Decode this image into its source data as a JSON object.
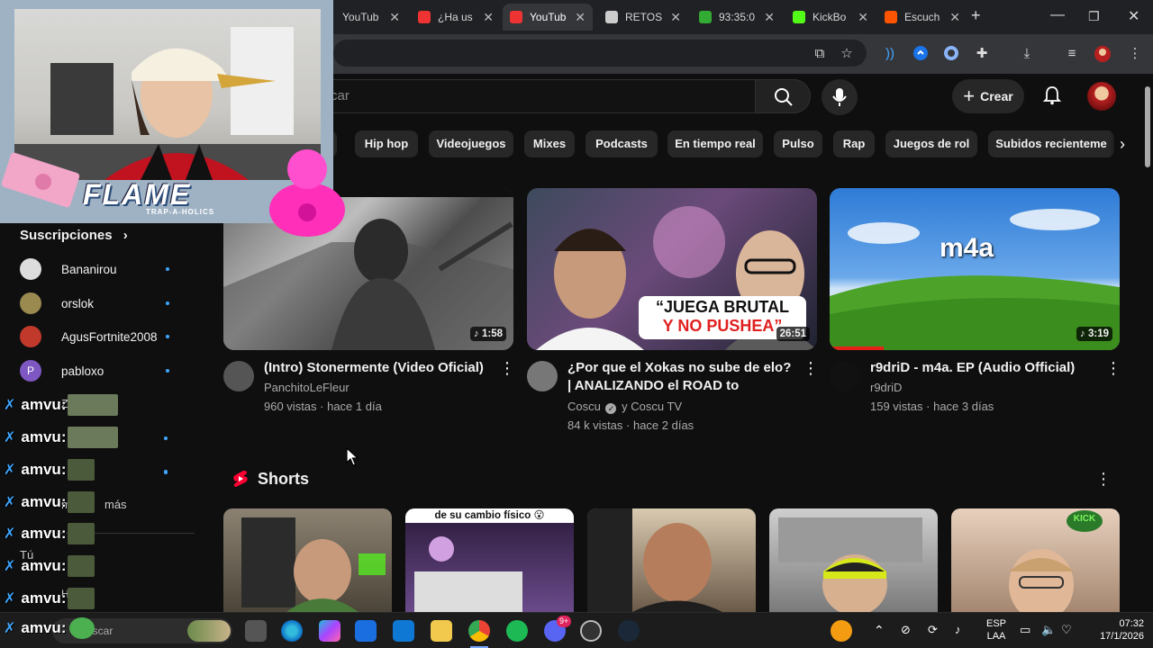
{
  "browser": {
    "tabs": [
      {
        "title": "YouTub",
        "active": false,
        "fav": "#e33"
      },
      {
        "title": "¿Ha us",
        "active": false,
        "fav": "#e33"
      },
      {
        "title": "YouTub",
        "active": true,
        "fav": "#e33"
      },
      {
        "title": "RETOS",
        "active": false,
        "fav": "#ccc"
      },
      {
        "title": "93:35:0",
        "active": false,
        "fav": "#3a3"
      },
      {
        "title": "KickBo",
        "active": false,
        "fav": "#53fc18"
      },
      {
        "title": "Escuch",
        "active": false,
        "fav": "#f50"
      }
    ],
    "new_tab_label": "+"
  },
  "youtube": {
    "search_placeholder": "car",
    "create_label": "Crear",
    "chips": [
      "Hip hop",
      "Videojuegos",
      "Mixes",
      "Podcasts",
      "En tiempo real",
      "Pulso",
      "Rap",
      "Juegos de rol",
      "Subidos recienteme"
    ],
    "sidebar": {
      "subs_title": "Suscripciones",
      "items": [
        {
          "name": "Bananirou",
          "color": "#ddd"
        },
        {
          "name": "orslok",
          "color": "#9a8a50"
        },
        {
          "name": "AgusFortnite2008",
          "color": "#c0392b"
        },
        {
          "name": "pabloxo",
          "color": "#7e57c2",
          "initial": "P"
        }
      ],
      "hidden_fragments": [
        "ZE",
        "os",
        "uz",
        "mos",
        "más",
        "Tú",
        "His"
      ]
    },
    "videos": [
      {
        "title": "(Intro) Stonermente (Video Oficial)",
        "channel": "PanchitoLeFleur",
        "stats": "960 vistas · hace 1 día",
        "duration": "♪ 1:58"
      },
      {
        "title": "¿Por que el Xokas no sube de elo? | ANALIZANDO el ROAD to MASTER ...",
        "channel": "Coscu",
        "channel_extra": "y Coscu TV",
        "stats": "84 k vistas · hace 2 días",
        "duration": "26:51",
        "thumb_text": "“JUEGA BRUTAL",
        "thumb_text2": "Y NO PUSHEA”"
      },
      {
        "title": "r9driD - m4a. EP (Audio Official)",
        "channel": "r9driD",
        "stats": "159 vistas · hace 3 días",
        "duration": "♪ 3:19",
        "thumb_text": "m4a"
      }
    ],
    "shorts_title": "Shorts",
    "shorts": [
      {
        "caption": ""
      },
      {
        "caption": "de su cambio físico 😮"
      },
      {
        "caption": ""
      },
      {
        "caption": ""
      },
      {
        "caption": "",
        "badge": "KICK"
      }
    ]
  },
  "overlay": {
    "brand": "FLAME",
    "brand_sub": "TRAP-A-HOLICS",
    "chat_user": "amvu:",
    "chat_lines": 8
  },
  "taskbar": {
    "search_label": "Buscar",
    "lang1": "ESP",
    "lang2": "LAA",
    "time": "07:32",
    "date": "17/1/2026",
    "notif_count": "9+"
  }
}
